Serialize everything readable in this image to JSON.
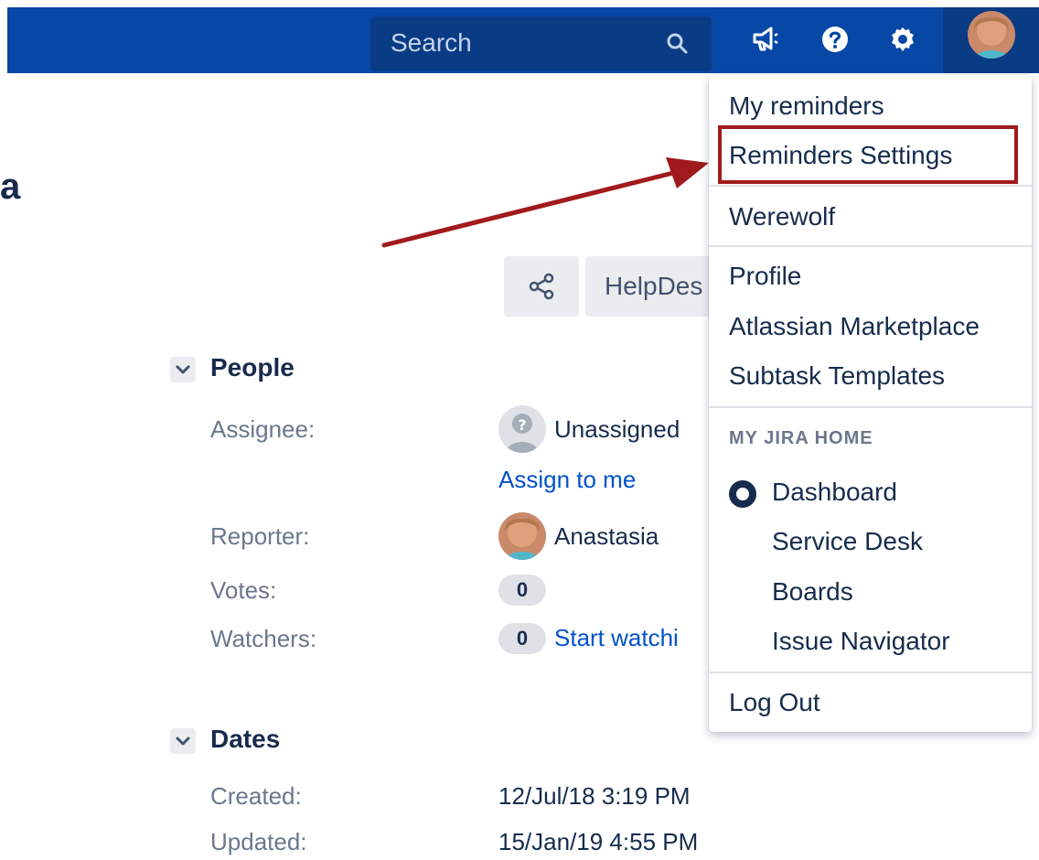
{
  "topbar": {
    "search_placeholder": "Search",
    "search_icon": "magnifier-icon",
    "icons": [
      "megaphone-icon",
      "help-icon",
      "settings-gear-icon",
      "user-avatar"
    ]
  },
  "page": {
    "partial_title": "a",
    "share_icon": "share-icon",
    "helpdesk_label": "HelpDes"
  },
  "people": {
    "title": "People",
    "assignee_label": "Assignee:",
    "assignee_value": "Unassigned",
    "assign_to_me": "Assign to me",
    "reporter_label": "Reporter:",
    "reporter_value": "Anastasia",
    "votes_label": "Votes:",
    "votes_count": "0",
    "watchers_label": "Watchers:",
    "watchers_count": "0",
    "start_watching": "Start watchi"
  },
  "dates": {
    "title": "Dates",
    "created_label": "Created:",
    "created_value": "12/Jul/18 3:19 PM",
    "updated_label": "Updated:",
    "updated_value": "15/Jan/19 4:55 PM"
  },
  "menu": {
    "my_reminders": "My reminders",
    "reminders_settings": "Reminders Settings",
    "werewolf": "Werewolf",
    "profile": "Profile",
    "atlassian_marketplace": "Atlassian Marketplace",
    "subtask_templates": "Subtask Templates",
    "group_heading": "MY JIRA HOME",
    "dashboard": "Dashboard",
    "service_desk": "Service Desk",
    "boards": "Boards",
    "issue_navigator": "Issue Navigator",
    "log_out": "Log Out"
  },
  "colors": {
    "topbar": "#0747a6",
    "link": "#0052cc",
    "annotation": "#a11a1d"
  }
}
